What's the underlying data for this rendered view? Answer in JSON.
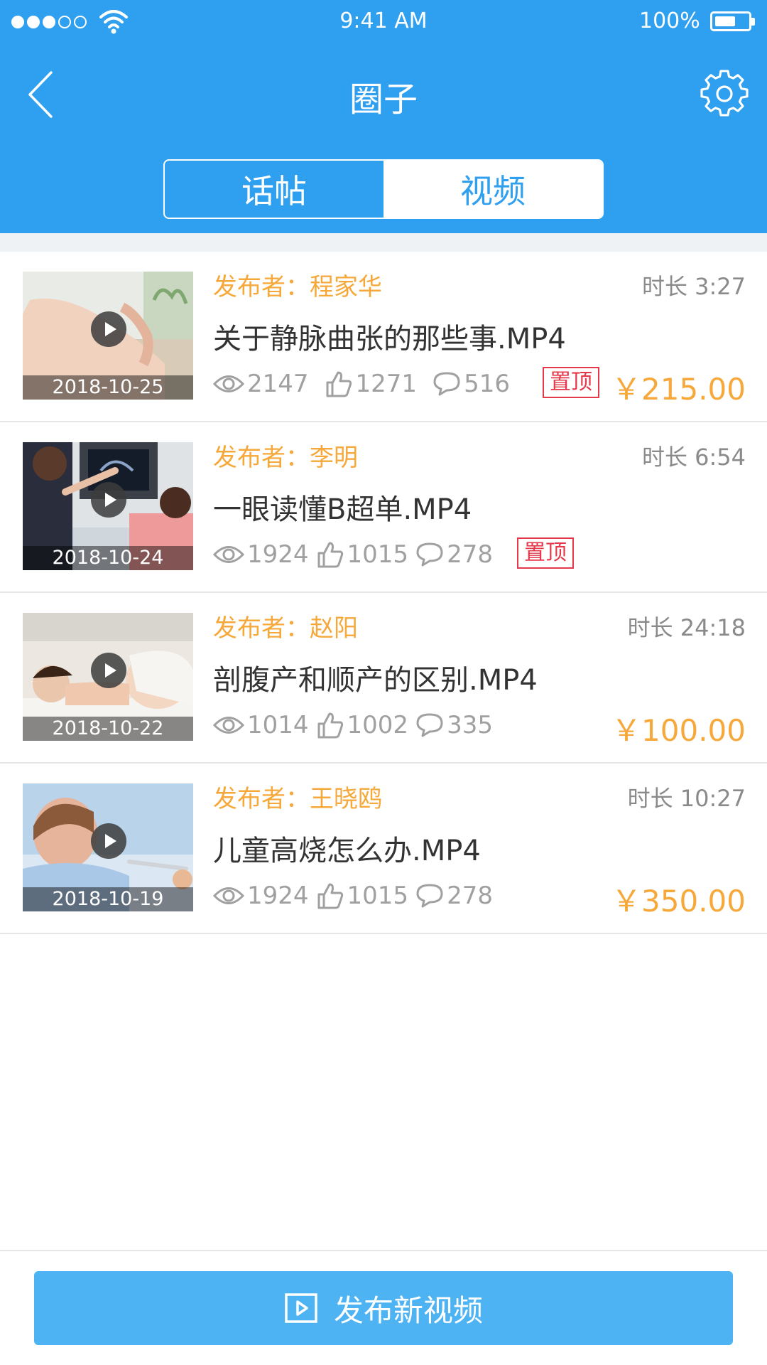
{
  "status_bar": {
    "time": "9:41 AM",
    "battery": "100%"
  },
  "header": {
    "title": "圈子"
  },
  "tabs": [
    {
      "label": "话帖",
      "active": false
    },
    {
      "label": "视频",
      "active": true
    }
  ],
  "videos": [
    {
      "date": "2018-10-25",
      "author": "发布者：程家华",
      "duration": "时长 3:27",
      "title": "关于静脉曲张的那些事.MP4",
      "views": "2147",
      "likes": "1271",
      "comments": "516",
      "pinned": "置顶",
      "price": "￥215.00"
    },
    {
      "date": "2018-10-24",
      "author": "发布者：李明",
      "duration": "时长 6:54",
      "title": "一眼读懂B超单.MP4",
      "views": "1924",
      "likes": "1015",
      "comments": "278",
      "pinned": "置顶",
      "price": ""
    },
    {
      "date": "2018-10-22",
      "author": "发布者：赵阳",
      "duration": "时长 24:18",
      "title": "剖腹产和顺产的区别.MP4",
      "views": "1014",
      "likes": "1002",
      "comments": "335",
      "pinned": "",
      "price": "￥100.00"
    },
    {
      "date": "2018-10-19",
      "author": "发布者：王晓鸥",
      "duration": "时长 10:27",
      "title": "儿童高烧怎么办.MP4",
      "views": "1924",
      "likes": "1015",
      "comments": "278",
      "pinned": "",
      "price": "￥350.00"
    }
  ],
  "publish_button": {
    "label": "发布新视频"
  },
  "colors": {
    "primary": "#2f9ff0",
    "accent": "#f6a83a",
    "pin": "#e5384a",
    "button": "#4db3f3"
  },
  "icons": {
    "back": "chevron-left-icon",
    "settings": "gear-icon",
    "views": "eye-icon",
    "likes": "thumbs-up-icon",
    "comments": "comment-icon",
    "play": "play-icon",
    "publish": "video-play-icon"
  }
}
